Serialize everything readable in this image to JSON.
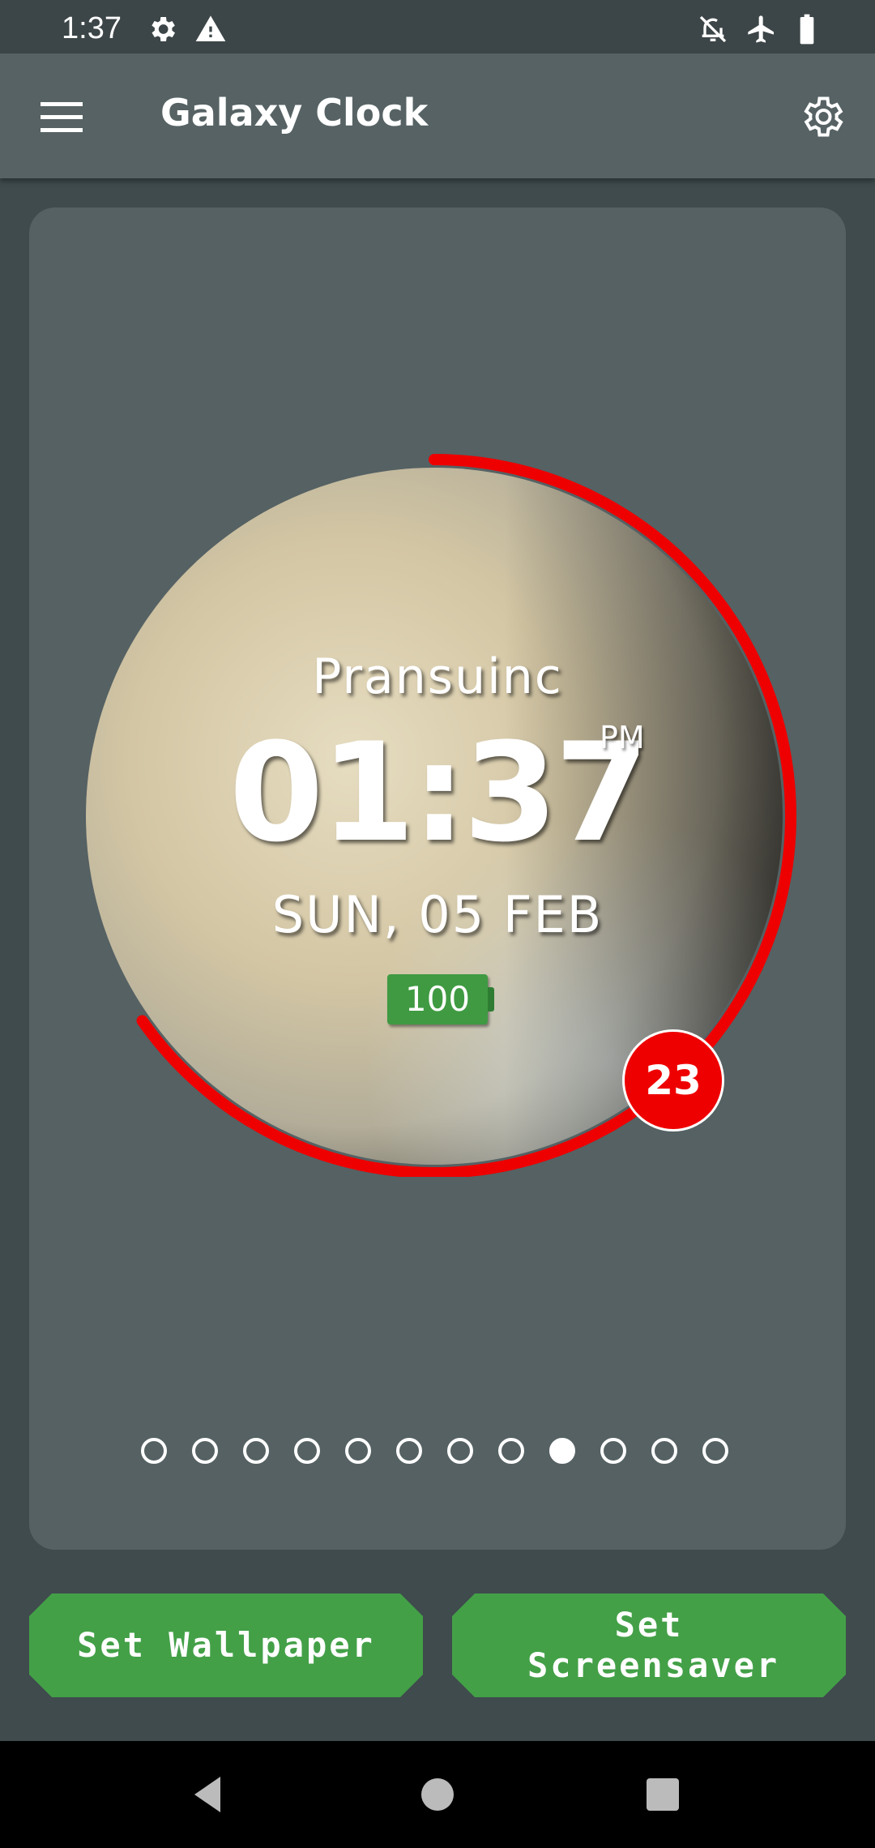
{
  "status_bar": {
    "time": "1:37",
    "icons": [
      "settings-icon",
      "warning-icon",
      "notifications-off-icon",
      "airplane-icon",
      "battery-icon"
    ]
  },
  "app_bar": {
    "title": "Galaxy Clock",
    "menu_icon": "menu-icon",
    "settings_icon": "gear-icon"
  },
  "preview": {
    "brand": "Pransuinc",
    "time": "01:37",
    "ampm": "PM",
    "date": "SUN, 05 FEB",
    "battery_level": "100",
    "seconds_badge": "23",
    "seconds_progress": 0.38,
    "ring_color": "#ee0000"
  },
  "pager": {
    "count": 12,
    "active_index": 8
  },
  "buttons": {
    "set_wallpaper": "Set Wallpaper",
    "set_screensaver": "Set Screensaver"
  },
  "colors": {
    "button_green": "#43a047",
    "card": "#556163",
    "app_bar": "#566264"
  }
}
